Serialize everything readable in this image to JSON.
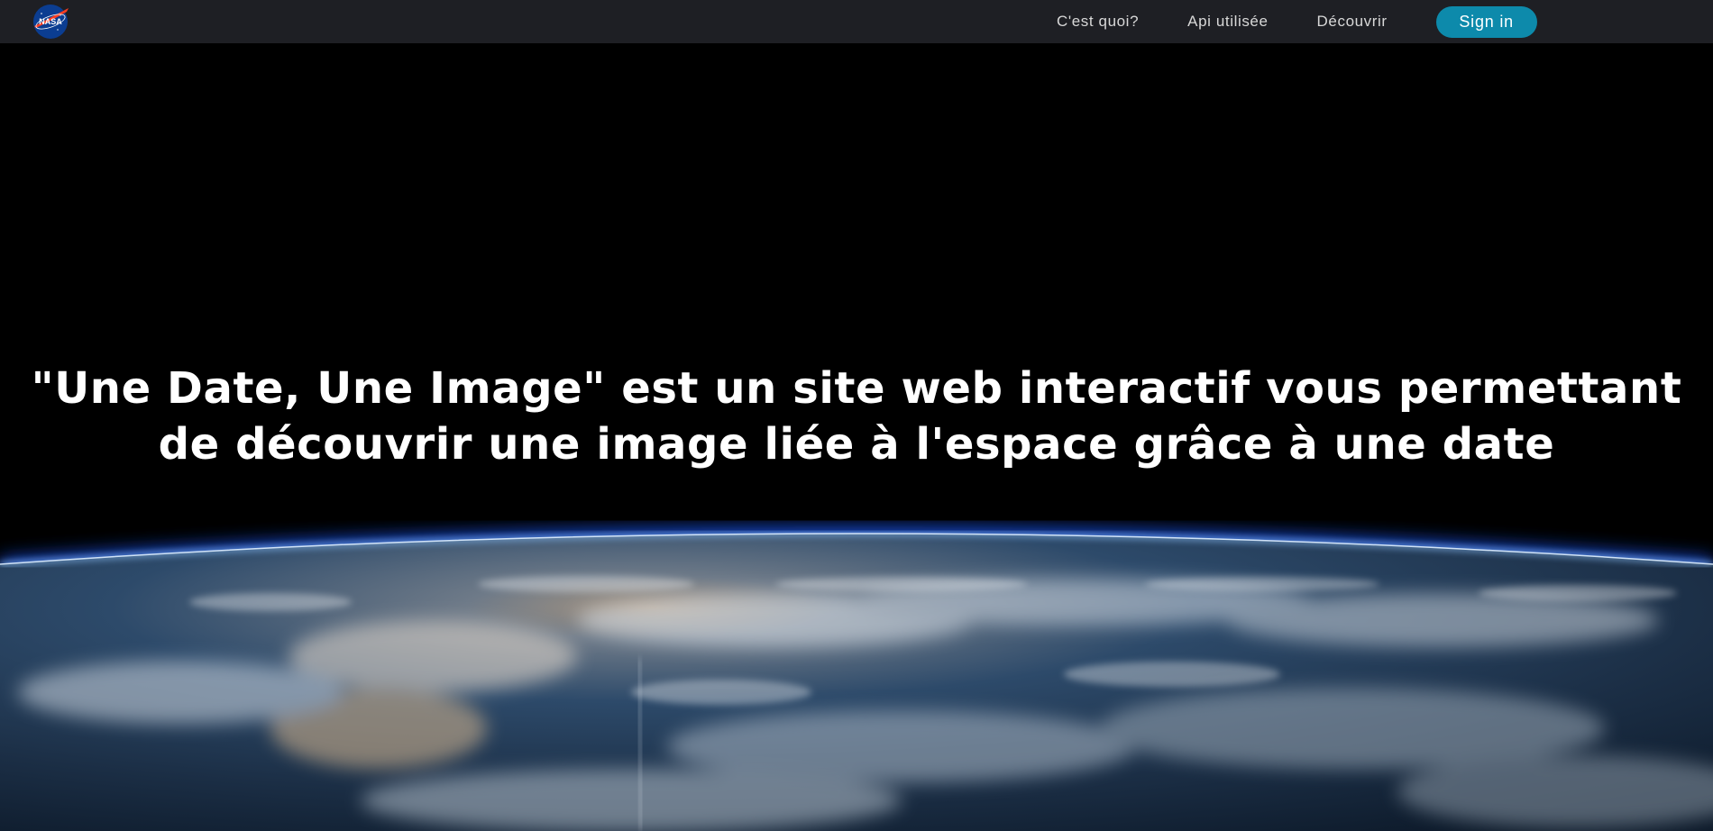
{
  "navbar": {
    "logo_icon": "nasa-logo",
    "logo_text": "NASA",
    "links": [
      {
        "label": "C'est quoi?"
      },
      {
        "label": "Api utilisée"
      },
      {
        "label": "Découvrir"
      }
    ],
    "signin_label": "Sign in",
    "colors": {
      "bar": "#1e1f24",
      "button": "#0d8aab"
    }
  },
  "hero": {
    "title_line1": "\"Une Date, Une Image\" est un site web interactif vous permettant",
    "title_line2": "de découvrir une image liée à l'espace grâce à une date",
    "background_image": "earth-from-space"
  }
}
